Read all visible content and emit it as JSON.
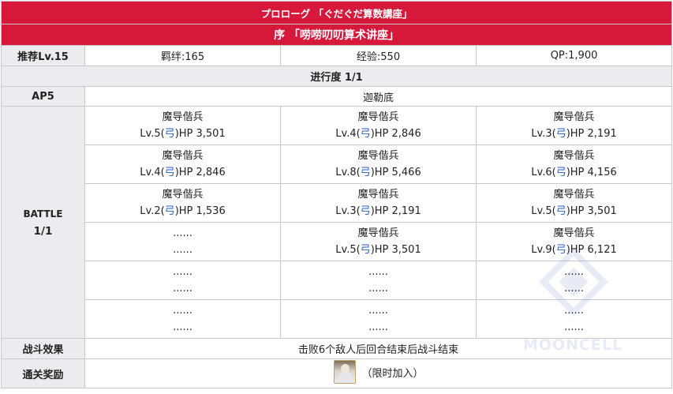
{
  "header": {
    "subtitle": "プロローグ 「ぐだぐだ算数講座」",
    "title": "序 「唠唠叨叨算术讲座」"
  },
  "info": {
    "level_label": "推荐Lv.15",
    "bond": "羁绊:165",
    "exp": "经验:550",
    "qp": "QP:1,900"
  },
  "progress": "进行度 1/1",
  "ap": {
    "label": "AP5",
    "location": "迦勒底"
  },
  "battle": {
    "label": "BATTLE",
    "count": "1/1",
    "rows": [
      [
        {
          "name": "魔导偕兵",
          "lv": "Lv.5(",
          "cls": "弓",
          "hp": ")HP 3,501"
        },
        {
          "name": "魔导偕兵",
          "lv": "Lv.4(",
          "cls": "弓",
          "hp": ")HP 2,846"
        },
        {
          "name": "魔导偕兵",
          "lv": "Lv.3(",
          "cls": "弓",
          "hp": ")HP 2,191"
        }
      ],
      [
        {
          "name": "魔导偕兵",
          "lv": "Lv.4(",
          "cls": "弓",
          "hp": ")HP 2,846"
        },
        {
          "name": "魔导偕兵",
          "lv": "Lv.8(",
          "cls": "弓",
          "hp": ")HP 5,466"
        },
        {
          "name": "魔导偕兵",
          "lv": "Lv.6(",
          "cls": "弓",
          "hp": ")HP 4,156"
        }
      ],
      [
        {
          "name": "魔导偕兵",
          "lv": "Lv.2(",
          "cls": "弓",
          "hp": ")HP 1,536"
        },
        {
          "name": "魔导偕兵",
          "lv": "Lv.3(",
          "cls": "弓",
          "hp": ")HP 2,191"
        },
        {
          "name": "魔导偕兵",
          "lv": "Lv.5(",
          "cls": "弓",
          "hp": ")HP 3,501"
        }
      ],
      [
        {
          "name": "......",
          "stats": "......"
        },
        {
          "name": "魔导偕兵",
          "lv": "Lv.5(",
          "cls": "弓",
          "hp": ")HP 3,501"
        },
        {
          "name": "魔导偕兵",
          "lv": "Lv.9(",
          "cls": "弓",
          "hp": ")HP 6,121"
        }
      ],
      [
        {
          "name": "......",
          "stats": "......"
        },
        {
          "name": "......",
          "stats": "......"
        },
        {
          "name": "......",
          "stats": "......"
        }
      ],
      [
        {
          "name": "......",
          "stats": "......"
        },
        {
          "name": "......",
          "stats": "......"
        },
        {
          "name": "......",
          "stats": "......"
        }
      ]
    ]
  },
  "effect": {
    "label": "战斗效果",
    "text": "击败6个敌人后回合结束后战斗结束"
  },
  "reward": {
    "label": "通关奖励",
    "icon": "servant-portrait-icon",
    "text": "（限时加入）"
  },
  "watermark": {
    "text": "MOONCELL"
  },
  "colors": {
    "header_bg": "#d6193b",
    "label_bg": "#eaecf0",
    "class_text": "#2a5fd0",
    "border": "#c8c8c8"
  }
}
